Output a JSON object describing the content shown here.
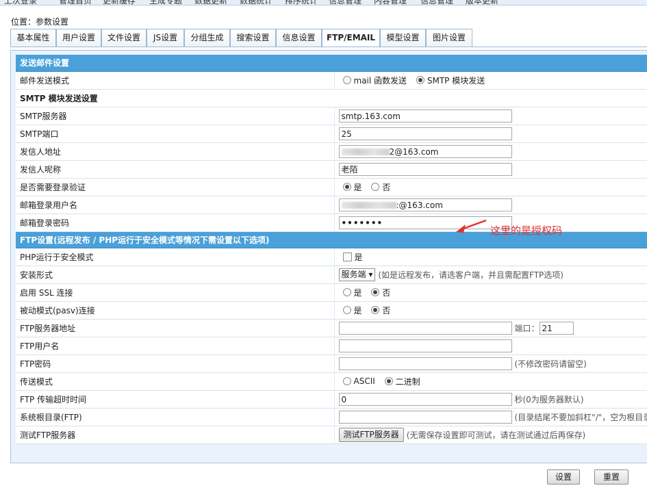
{
  "topbar": {
    "items": [
      "上次登录",
      "管理首页",
      "更新缓存",
      "生成专题",
      "数据更新",
      "数据统计",
      "排序统计",
      "信息管理",
      "内容管理",
      "信息管理",
      "版本更新"
    ]
  },
  "location": "位置：参数设置",
  "tabs": [
    "基本属性",
    "用户设置",
    "文件设置",
    "JS设置",
    "分组生成",
    "搜索设置",
    "信息设置",
    "FTP/EMAIL",
    "模型设置",
    "图片设置"
  ],
  "active_tab": "FTP/EMAIL",
  "email_section": {
    "title": "发送邮件设置",
    "mode": {
      "label": "邮件发送模式",
      "opt1": "mail 函数发送",
      "opt2": "SMTP 模块发送",
      "selected": "opt2"
    },
    "smtp_header": "SMTP 模块发送设置",
    "smtp_server": {
      "label": "SMTP服务器",
      "value": "smtp.163.com"
    },
    "smtp_port": {
      "label": "SMTP端口",
      "value": "25"
    },
    "sender_address": {
      "label": "发信人地址",
      "value": "2@163.com"
    },
    "sender_nickname": {
      "label": "发信人呢称",
      "value": "老陌"
    },
    "need_auth": {
      "label": "是否需要登录验证",
      "yes": "是",
      "no": "否",
      "selected": "yes"
    },
    "login_user": {
      "label": "邮箱登录用户名",
      "value": ":@163.com"
    },
    "login_password": {
      "label": "邮箱登录密码",
      "value": "•••••••"
    }
  },
  "annotation": {
    "text": "这里的是授权码",
    "color": "#e03030"
  },
  "ftp_section": {
    "title": "FTP设置(远程发布 / PHP运行于安全模式等情况下需设置以下选项)",
    "php_safe_mode": {
      "label": "PHP运行于安全模式",
      "check_label": "是"
    },
    "install_type": {
      "label": "安装形式",
      "selected": "服务端 ▾",
      "hint": "(如是远程发布，请选客户端，并且需配置FTP选项)"
    },
    "ssl": {
      "label": "启用 SSL 连接",
      "yes": "是",
      "no": "否",
      "selected": "no"
    },
    "pasv": {
      "label": "被动模式(pasv)连接",
      "yes": "是",
      "no": "否",
      "selected": "no"
    },
    "ftp_host": {
      "label": "FTP服务器地址",
      "value": "",
      "port_label": "端口：",
      "port_value": "21"
    },
    "ftp_user": {
      "label": "FTP用户名",
      "value": ""
    },
    "ftp_password": {
      "label": "FTP密码",
      "value": "",
      "hint": "(不修改密码请留空)"
    },
    "transfer_mode": {
      "label": "传送模式",
      "opt1": "ASCII",
      "opt2": "二进制",
      "selected": "opt2"
    },
    "timeout": {
      "label": "FTP 传输超时时间",
      "value": "0",
      "hint": "秒(0为服务器默认)"
    },
    "root_dir": {
      "label": "系统根目录(FTP)",
      "value": "",
      "hint": "(目录结尾不要加斜杠\"/\"，空为根目录)"
    },
    "test": {
      "label": "测试FTP服务器",
      "button": "测试FTP服务器",
      "hint": "(无需保存设置即可测试，请在测试通过后再保存)"
    }
  },
  "footer": {
    "submit": "设置",
    "reset": "重置"
  },
  "colors": {
    "section_header": "#4aa0d8",
    "panel_bg": "#eaf3fb",
    "border": "#9cb8d2"
  }
}
